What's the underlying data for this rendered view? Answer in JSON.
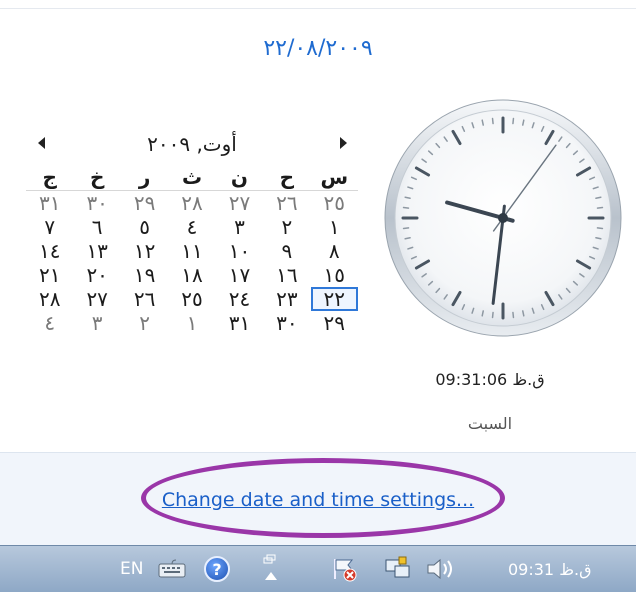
{
  "flyout": {
    "date_header": "٢٢/٠٨/٢٠٠٩",
    "calendar": {
      "month_title": "أوت, ٢٠٠٩",
      "weekdays": [
        "س",
        "ح",
        "ن",
        "ث",
        "ر",
        "خ",
        "ج"
      ],
      "weeks": [
        [
          "٢٥",
          "٢٦",
          "٢٧",
          "٢٨",
          "٢٩",
          "٣٠",
          "٣١"
        ],
        [
          "١",
          "٢",
          "٣",
          "٤",
          "٥",
          "٦",
          "٧"
        ],
        [
          "٨",
          "٩",
          "١٠",
          "١١",
          "١٢",
          "١٣",
          "١٤"
        ],
        [
          "١٥",
          "١٦",
          "١٧",
          "١٨",
          "١٩",
          "٢٠",
          "٢١"
        ],
        [
          "٢٢",
          "٢٣",
          "٢٤",
          "٢٥",
          "٢٦",
          "٢٧",
          "٢٨"
        ],
        [
          "٢٩",
          "٣٠",
          "٣١",
          "١",
          "٢",
          "٣",
          "٤"
        ]
      ],
      "selected": "٢٢"
    },
    "clock": {
      "time_text": "ق.ظ 09:31:06",
      "day_text": "السبت",
      "hours": 9,
      "minutes": 31,
      "seconds": 6
    },
    "footer": {
      "link_text": "Change date and time settings...",
      "highlight_color": "#9a36a8"
    }
  },
  "taskbar": {
    "language": "EN",
    "clock": "ق.ظ 09:31",
    "icons": [
      "keyboard-icon",
      "help-icon",
      "show-hidden-icons",
      "action-center-flag-icon",
      "network-icon",
      "volume-icon"
    ]
  }
}
